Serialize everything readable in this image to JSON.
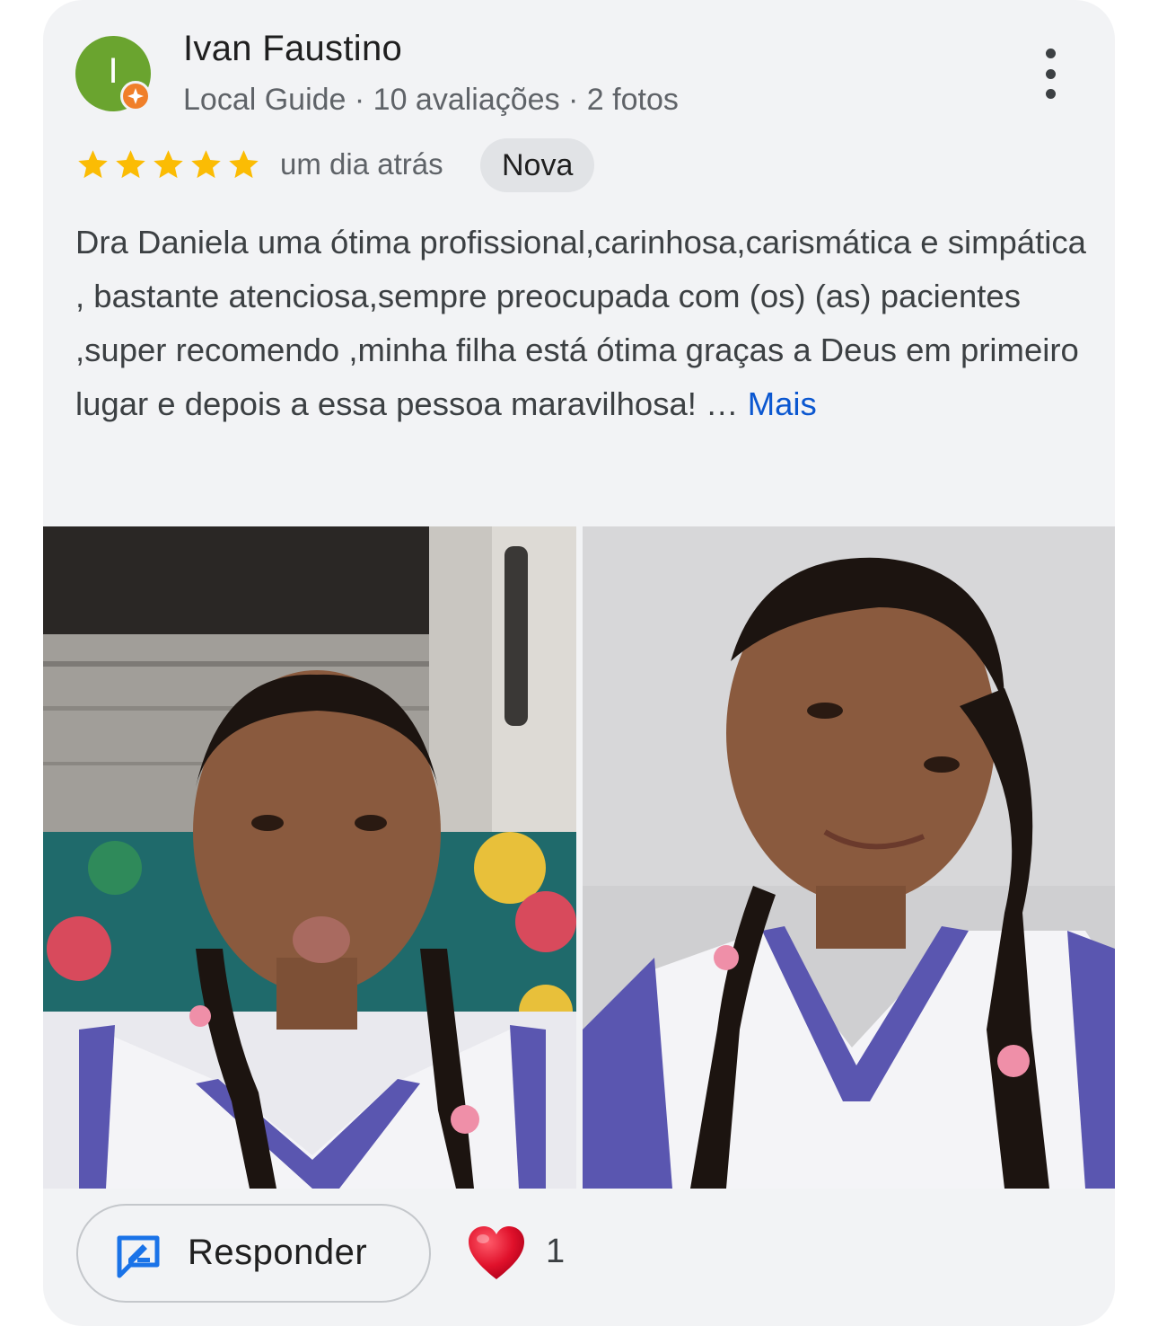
{
  "review": {
    "author": "Ivan Faustino",
    "avatar_letter": "I",
    "author_meta": "Local Guide · 10 avaliações · 2 fotos",
    "rating": 5,
    "time_ago": "um dia atrás",
    "badge": "Nova",
    "text": "Dra Daniela uma ótima profissional,carinhosa,carismática e simpática , bastante atenciosa,sempre preocupada com (os) (as) pacientes ,super recomendo ,minha filha está ótima graças a Deus em primeiro lugar e depois a essa pessoa maravilhosa!",
    "ellipsis": "…",
    "more_link": "Mais",
    "photos": [
      "photo-1",
      "photo-2"
    ]
  },
  "actions": {
    "reply_label": "Responder",
    "reaction_icon": "heart-icon",
    "reaction_count": "1"
  },
  "colors": {
    "card_bg": "#f2f3f5",
    "avatar_bg": "#6aa42f",
    "guide_badge": "#f07f2a",
    "star": "#fbbc04",
    "link": "#0b57d0",
    "reply_icon": "#1a73e8",
    "heart": "#e0112b"
  }
}
